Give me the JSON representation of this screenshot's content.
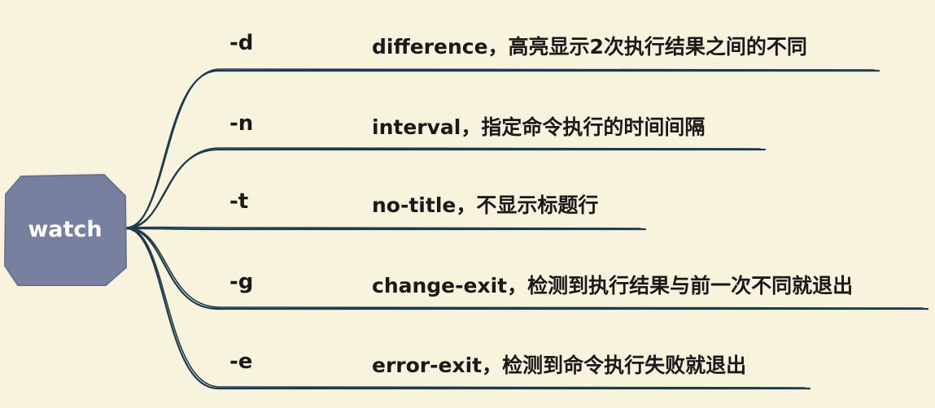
{
  "root": {
    "label": "watch"
  },
  "branches": [
    {
      "flag": "-d",
      "description": "difference，高亮显示2次执行结果之间的不同"
    },
    {
      "flag": "-n",
      "description": "interval，指定命令执行的时间间隔"
    },
    {
      "flag": "-t",
      "description": "no-title，不显示标题行"
    },
    {
      "flag": "-g",
      "description": "change-exit，检测到执行结果与前一次不同就退出"
    },
    {
      "flag": "-e",
      "description": "error-exit，检测到命令执行失败就退出"
    }
  ],
  "colors": {
    "background": "#f8f3dc",
    "root_fill": "#7880a0",
    "line": "#1f3a4d",
    "text": "#1a1a1a"
  }
}
